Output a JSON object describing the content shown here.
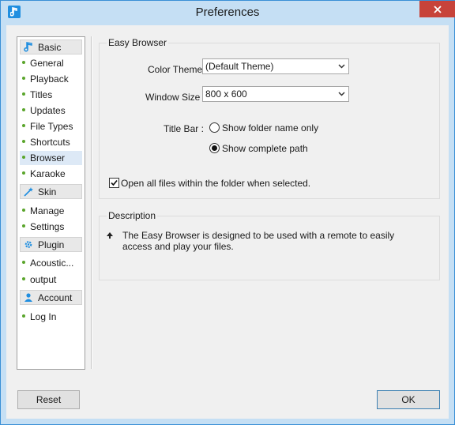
{
  "window": {
    "title": "Preferences"
  },
  "sidebar": {
    "sections": [
      {
        "label": "Basic",
        "icon": "music-note-icon",
        "items": [
          {
            "label": "General"
          },
          {
            "label": "Playback"
          },
          {
            "label": "Titles"
          },
          {
            "label": "Updates"
          },
          {
            "label": "File Types"
          },
          {
            "label": "Shortcuts"
          },
          {
            "label": "Browser",
            "selected": true
          },
          {
            "label": "Karaoke"
          }
        ]
      },
      {
        "label": "Skin",
        "icon": "magic-wand-icon",
        "items": [
          {
            "label": "Manage"
          },
          {
            "label": "Settings"
          }
        ]
      },
      {
        "label": "Plugin",
        "icon": "gear-icon",
        "items": [
          {
            "label": "Acoustic..."
          },
          {
            "label": "output"
          }
        ]
      },
      {
        "label": "Account",
        "icon": "user-icon",
        "items": [
          {
            "label": "Log In"
          }
        ]
      }
    ]
  },
  "easy_browser": {
    "group_title": "Easy Browser",
    "color_theme_label": "Color Theme :",
    "color_theme_value": "(Default Theme)",
    "window_size_label": "Window Size :",
    "window_size_value": "800 x 600",
    "title_bar_label": "Title Bar :",
    "radio_folder_name": "Show folder name only",
    "radio_complete_path": "Show complete path",
    "selected_radio": "complete_path",
    "open_all_label": "Open all files within the folder when selected.",
    "open_all_checked": true
  },
  "description": {
    "group_title": "Description",
    "text": "The Easy Browser is designed to be used with a remote to easily access and play your files."
  },
  "footer": {
    "reset_label": "Reset",
    "ok_label": "OK"
  },
  "colors": {
    "accent": "#3a8fd6",
    "titlebar": "#c5dff4",
    "close": "#c7433a",
    "bullet": "#5aa52b"
  }
}
